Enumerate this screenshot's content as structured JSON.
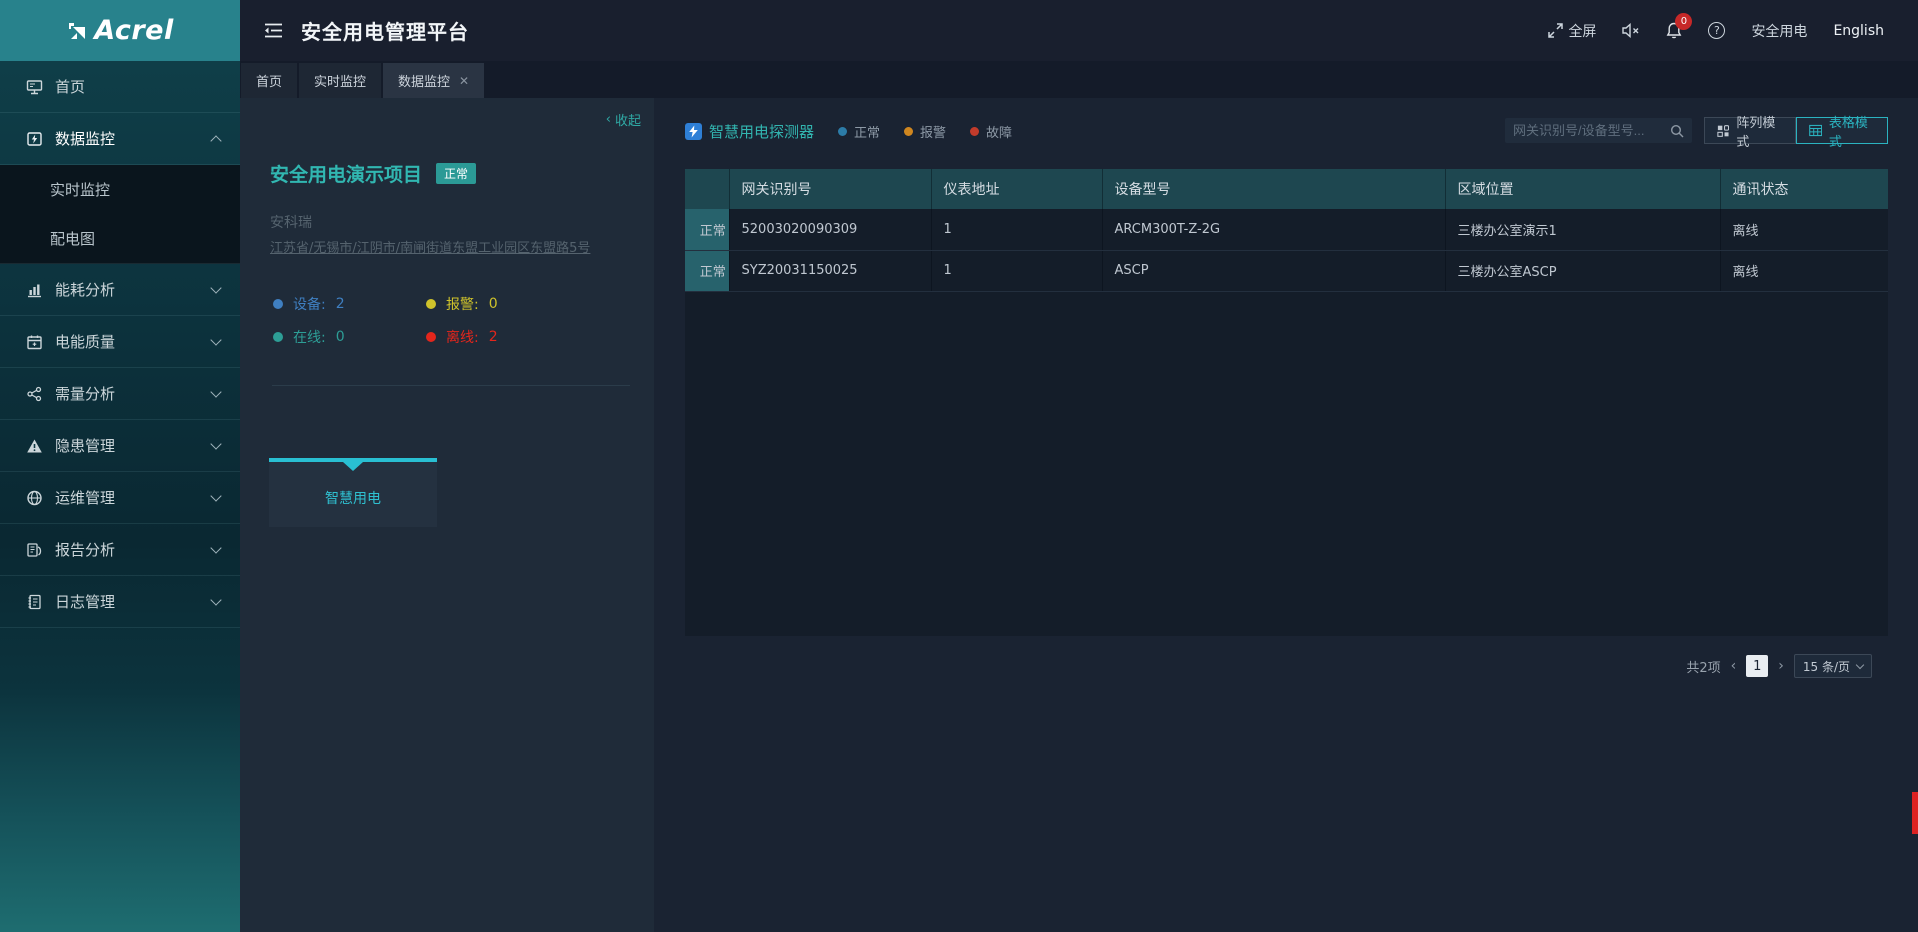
{
  "header": {
    "logo": "Acrel",
    "title": "安全用电管理平台",
    "fullscreen_label": "全屏",
    "badge_count": "0",
    "product_label": "安全用电",
    "language_label": "English"
  },
  "sidebar": {
    "items": [
      {
        "label": "首页",
        "icon": "home-icon"
      },
      {
        "label": "数据监控",
        "icon": "data-monitor-icon",
        "expanded": true
      },
      {
        "label": "能耗分析",
        "icon": "energy-chart-icon"
      },
      {
        "label": "电能质量",
        "icon": "calendar-icon"
      },
      {
        "label": "需量分析",
        "icon": "share-nodes-icon"
      },
      {
        "label": "隐患管理",
        "icon": "warning-icon"
      },
      {
        "label": "运维管理",
        "icon": "globe-icon"
      },
      {
        "label": "报告分析",
        "icon": "report-icon"
      },
      {
        "label": "日志管理",
        "icon": "log-icon"
      }
    ],
    "submenu": [
      "实时监控",
      "配电图"
    ]
  },
  "tabs": [
    {
      "label": "首页"
    },
    {
      "label": "实时监控"
    },
    {
      "label": "数据监控",
      "active": true,
      "closable": true
    }
  ],
  "panel": {
    "collapse_label": "收起",
    "title": "安全用电演示项目",
    "badge": "正常",
    "company": "安科瑞",
    "address": "江苏省/无锡市/江阴市/南闸街道东盟工业园区东盟路5号",
    "stats": [
      {
        "label": "设备:",
        "value": "2",
        "color": "#3f7fc1"
      },
      {
        "label": "报警:",
        "value": "0",
        "color": "#cfc32b"
      },
      {
        "label": "在线:",
        "value": "0",
        "color": "#2d9e96"
      },
      {
        "label": "离线:",
        "value": "2",
        "color": "#e3261c"
      }
    ],
    "tab_label": "智慧用电"
  },
  "main": {
    "title": "智慧用电探测器",
    "legend": [
      {
        "label": "正常",
        "color": "#2c7ca8"
      },
      {
        "label": "报警",
        "color": "#cf861f"
      },
      {
        "label": "故障",
        "color": "#c23b2b"
      }
    ],
    "search_placeholder": "网关识别号/设备型号...",
    "modes": [
      {
        "label": "阵列模式",
        "active": false
      },
      {
        "label": "表格模式",
        "active": true
      }
    ],
    "table": {
      "columns": [
        "",
        "网关识别号",
        "仪表地址",
        "设备型号",
        "区域位置",
        "通讯状态"
      ],
      "rows": [
        {
          "status": "正常",
          "cells": [
            "52003020090309",
            "1",
            "ARCM300T-Z-2G",
            "三楼办公室演示1",
            "离线"
          ]
        },
        {
          "status": "正常",
          "cells": [
            "SYZ20031150025",
            "1",
            "ASCP",
            "三楼办公室ASCP",
            "离线"
          ]
        }
      ]
    },
    "pagination": {
      "total": "共2项",
      "page": "1",
      "page_size": "15 条/页"
    }
  }
}
